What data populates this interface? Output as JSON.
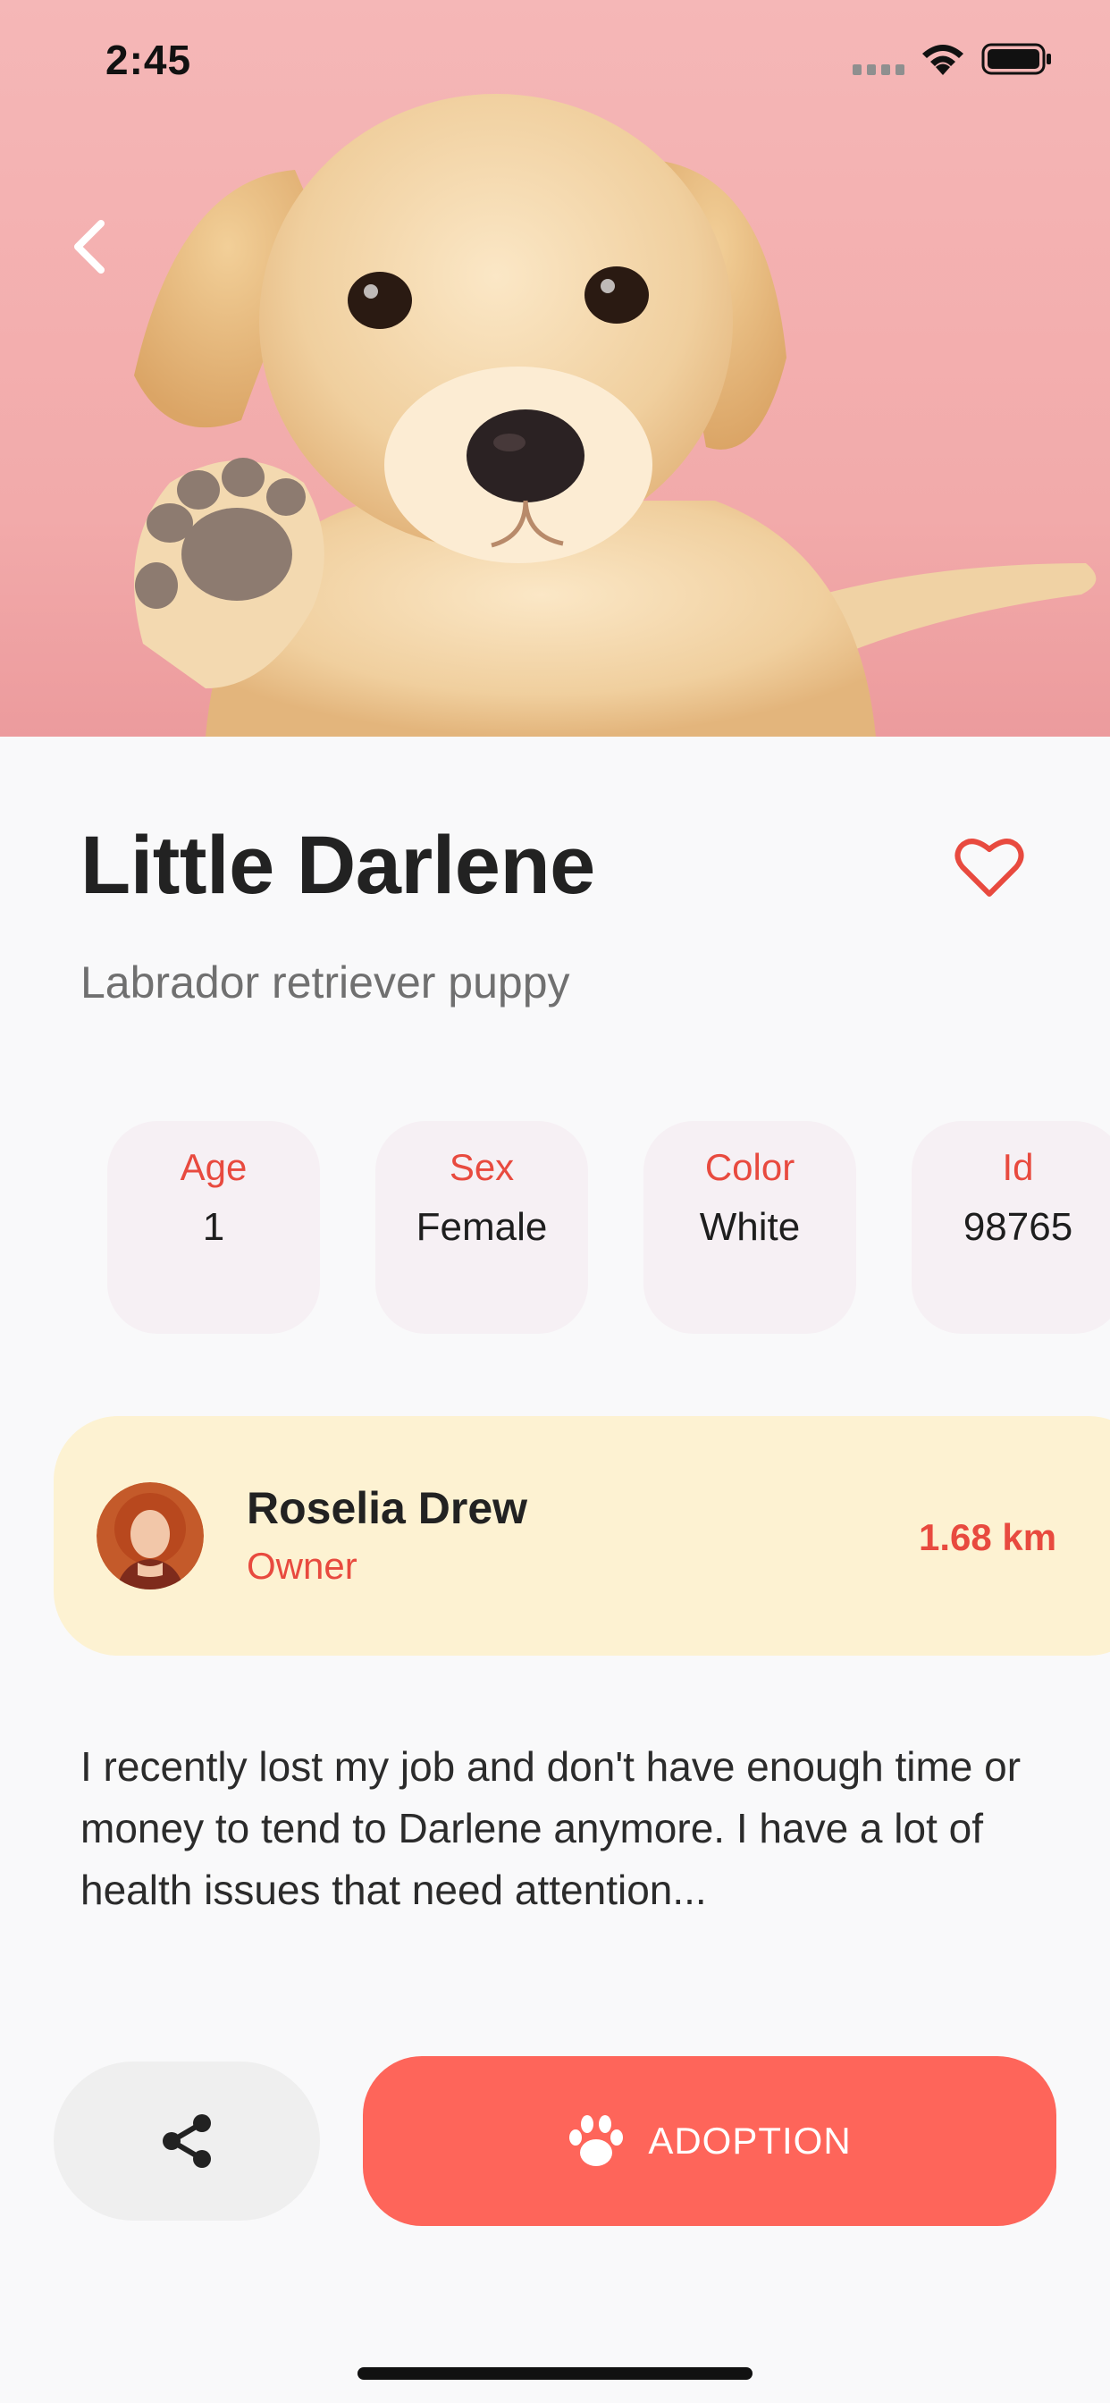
{
  "status_bar": {
    "time": "2:45"
  },
  "pet": {
    "name": "Little Darlene",
    "breed": "Labrador retriever puppy"
  },
  "attributes": [
    {
      "label": "Age",
      "value": "1"
    },
    {
      "label": "Sex",
      "value": "Female"
    },
    {
      "label": "Color",
      "value": "White"
    },
    {
      "label": "Id",
      "value": "98765"
    }
  ],
  "owner": {
    "name": "Roselia Drew",
    "role": "Owner",
    "distance": "1.68 km"
  },
  "description": "I recently lost my job and don't have enough time or money to tend to Darlene anymore. I have a lot of health issues that need attention...",
  "actions": {
    "adopt_label": "ADOPTION"
  },
  "icons": {
    "back": "chevron-left-icon",
    "favorite": "heart-outline-icon",
    "share": "share-icon",
    "adopt": "paw-icon"
  },
  "colors": {
    "accent": "#e84a3f",
    "adopt_button": "#fe655a",
    "hero_background": "#f5b7b7",
    "owner_card": "#fdf2d2",
    "attribute_card": "#f6f0f4"
  }
}
